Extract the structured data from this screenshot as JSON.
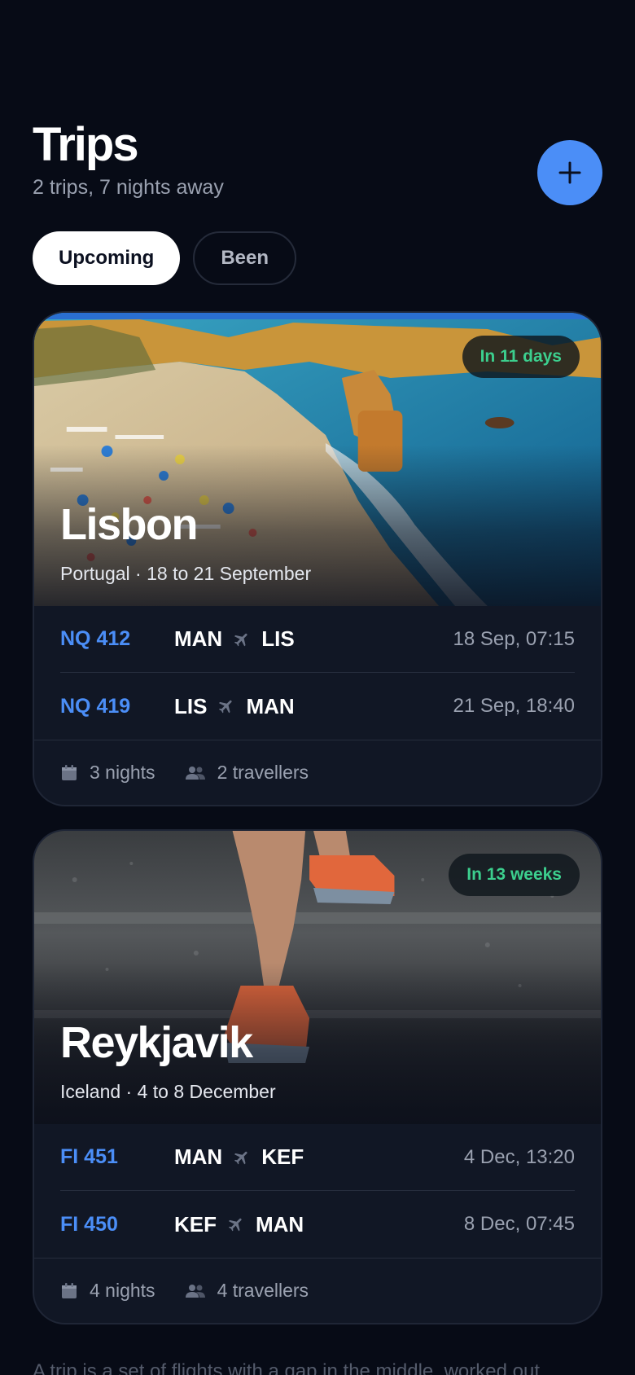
{
  "header": {
    "title": "Trips",
    "subtitle": "2 trips, 7 nights away"
  },
  "filters": {
    "upcoming": "Upcoming",
    "been": "Been",
    "selected": "Upcoming"
  },
  "trips": [
    {
      "city": "Lisbon",
      "place": "Portugal · 18 to 21 September",
      "badge": "In 11 days",
      "flights": [
        {
          "number": "NQ 412",
          "from": "MAN",
          "to": "LIS",
          "time": "18 Sep, 07:15"
        },
        {
          "number": "NQ 419",
          "from": "LIS",
          "to": "MAN",
          "time": "21 Sep, 18:40"
        }
      ],
      "nights": "3 nights",
      "travellers": "2 travellers"
    },
    {
      "city": "Reykjavik",
      "place": "Iceland · 4 to 8 December",
      "badge": "In 13 weeks",
      "flights": [
        {
          "number": "FI 451",
          "from": "MAN",
          "to": "KEF",
          "time": "4 Dec, 13:20"
        },
        {
          "number": "FI 450",
          "from": "KEF",
          "to": "MAN",
          "time": "8 Dec, 07:45"
        }
      ],
      "nights": "4 nights",
      "travellers": "4 travellers"
    }
  ],
  "note": "A trip is a set of flights with a gap in the middle, worked out",
  "colors": {
    "background": "#070b16",
    "accent": "#4b8ef7",
    "badge_text": "#3ccf8e",
    "muted": "#9aa1b0"
  },
  "icons": {
    "add": "plus-icon",
    "plane": "plane-icon",
    "nights": "calendar-icon",
    "travellers": "people-icon"
  }
}
